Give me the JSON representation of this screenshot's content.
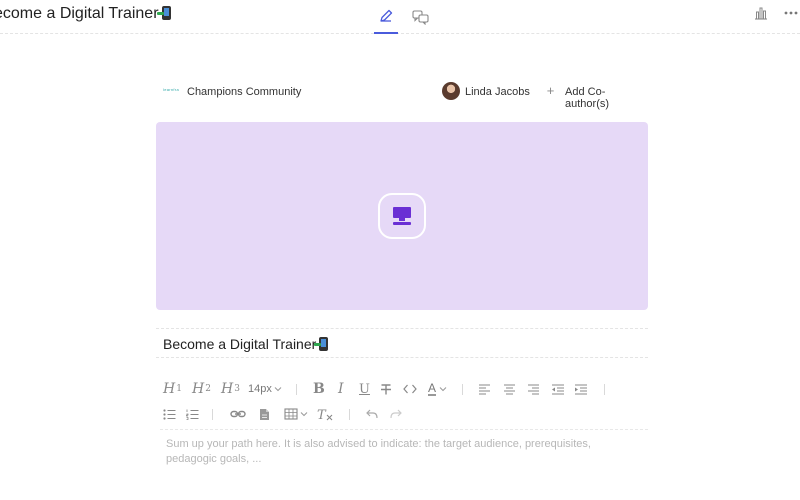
{
  "header": {
    "title": "ecome a Digital Trainer",
    "edit_tab_icon": "pencil-icon",
    "chat_tab_icon": "chat-bubbles-icon",
    "stats_icon": "bar-chart-icon",
    "more_icon": "more-dots-icon"
  },
  "author_bar": {
    "community_logo_text": "learnfra",
    "community_name": "Champions Community",
    "author_name": "Linda Jacobs",
    "add_coauthor_label": "Add Co-author(s)"
  },
  "cover": {
    "background_color": "#e6d9f7",
    "icon": "desktop-computer-icon",
    "icon_color": "#6a2fd4"
  },
  "title_field": {
    "value": "Become a Digital Trainer"
  },
  "toolbar": {
    "h1": "H",
    "h1_sub": "1",
    "h2": "H",
    "h2_sub": "2",
    "h3": "H",
    "h3_sub": "3",
    "font_size": "14px",
    "text_color_label": "A"
  },
  "summary": {
    "placeholder": "Sum up your path here. It is also advised to indicate: the target audience, prerequisites, pedagogic goals, ..."
  },
  "colors": {
    "accent": "#4a5bdc",
    "icon_gray": "#888888"
  }
}
